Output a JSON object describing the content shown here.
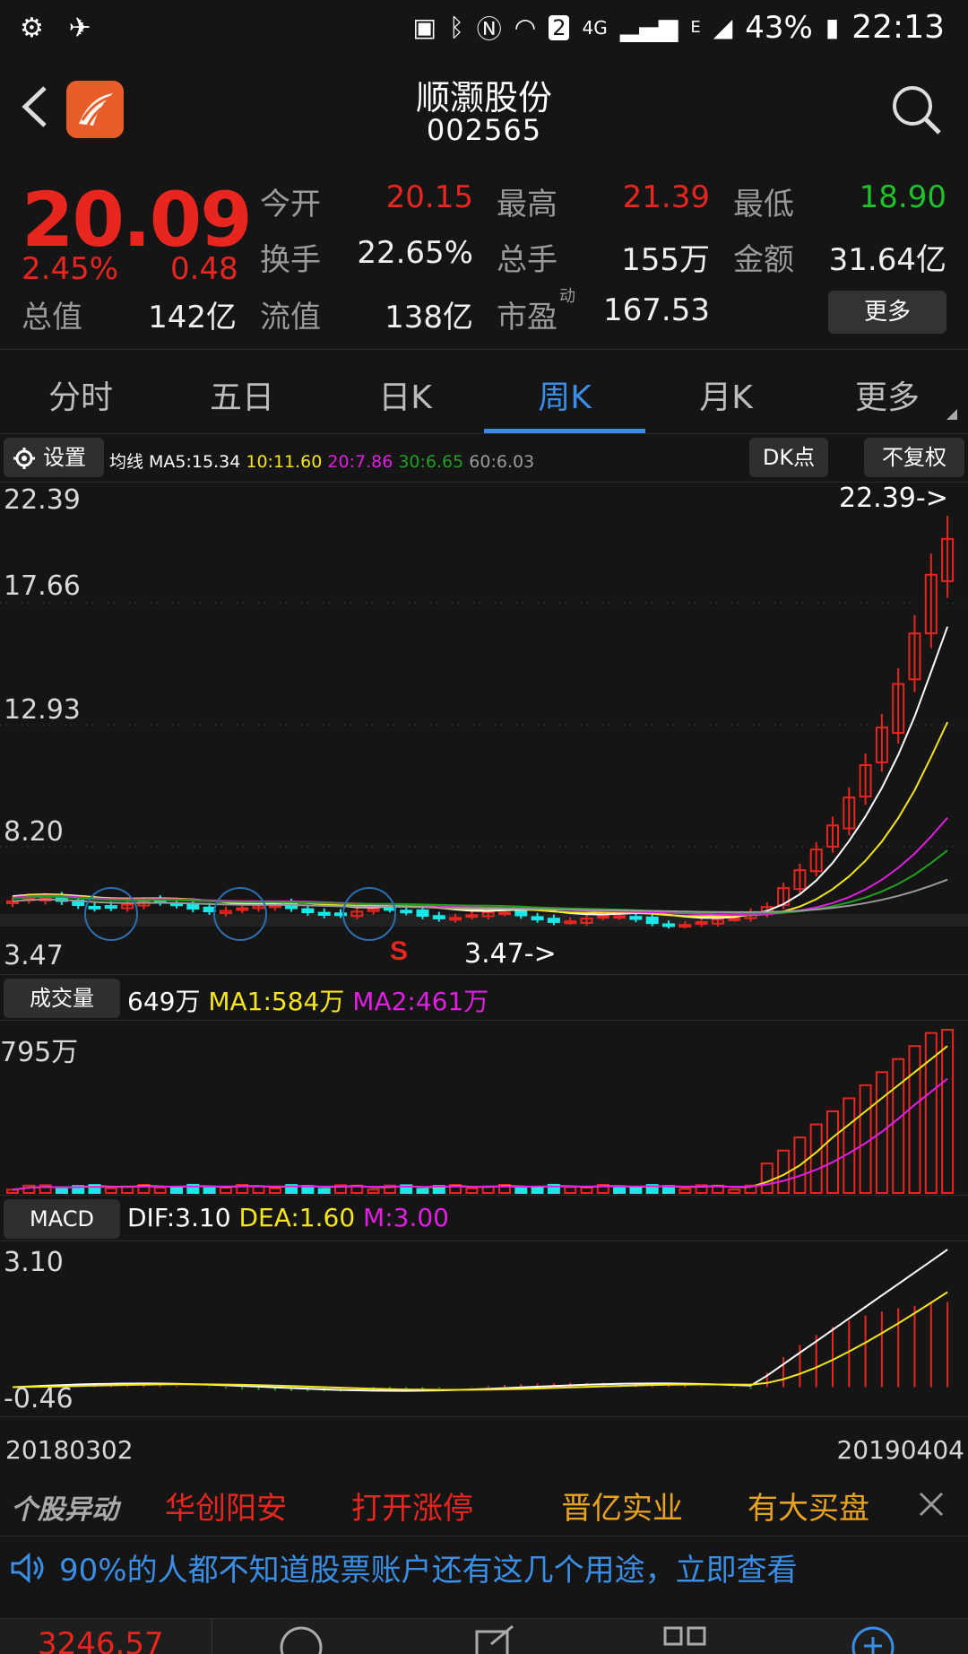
{
  "statusbar": {
    "battery": "43%",
    "time": "22:13",
    "network": "4G",
    "sim": "2",
    "network_e": "E"
  },
  "header": {
    "title": "顺灏股份",
    "code": "002565"
  },
  "quote": {
    "price": "20.09",
    "change_pct": "2.45%",
    "change_val": "0.48",
    "open_label": "今开",
    "open": "20.15",
    "high_label": "最高",
    "high": "21.39",
    "low_label": "最低",
    "low": "18.90",
    "turnover_label": "换手",
    "turnover": "22.65%",
    "volume_label": "总手",
    "volume": "155万",
    "amount_label": "金额",
    "amount": "31.64亿",
    "mktcap_label": "总值",
    "mktcap": "142亿",
    "float_label": "流值",
    "float": "138亿",
    "pe_label": "市盈",
    "pe_sup": "动",
    "pe": "167.53",
    "more_label": "更多"
  },
  "tabs": [
    "分时",
    "五日",
    "日K",
    "周K",
    "月K",
    "更多"
  ],
  "active_tab": "周K",
  "toolbar": {
    "settings_label": "设置",
    "ma_prefix": "均线 MA5:15.34",
    "ma10": "10:11.60",
    "ma20": "20:7.86",
    "ma30": "30:6.65",
    "ma60": "60:6.03",
    "dk_label": "DK点",
    "fq_label": "不复权"
  },
  "colors": {
    "up": "#e8261f",
    "down": "#19e8e8",
    "ma5": "#ffffff",
    "ma10": "#f5e61b",
    "ma20": "#e21fe2",
    "ma30": "#1fa01f",
    "ma60": "#9a9a9a",
    "accent": "#3a8ee6"
  },
  "kline": {
    "y_labels": [
      "22.39",
      "17.66",
      "12.93",
      "8.20",
      "3.47"
    ],
    "max_marker": "22.39->",
    "min_marker": "3.47->",
    "sell_marker": "S"
  },
  "volume": {
    "button": "成交量",
    "vol": "649万",
    "ma1": "MA1:584万",
    "ma2": "MA2:461万",
    "y_label": "795万"
  },
  "macd": {
    "button": "MACD",
    "dif": "DIF:3.10",
    "dea": "DEA:1.60",
    "m": "M:3.00",
    "y_top": "3.10",
    "y_bottom": "-0.46"
  },
  "dates": {
    "start": "20180302",
    "end": "20190404"
  },
  "ticker": {
    "title": "个股异动",
    "items": [
      "华创阳安",
      "打开涨停",
      "晋亿实业",
      "有大买盘"
    ]
  },
  "notice": {
    "text": "90%的人都不知道股票账户还有这几个用途，立即查看"
  },
  "bottomnav": {
    "index_value": "3246.57"
  }
}
